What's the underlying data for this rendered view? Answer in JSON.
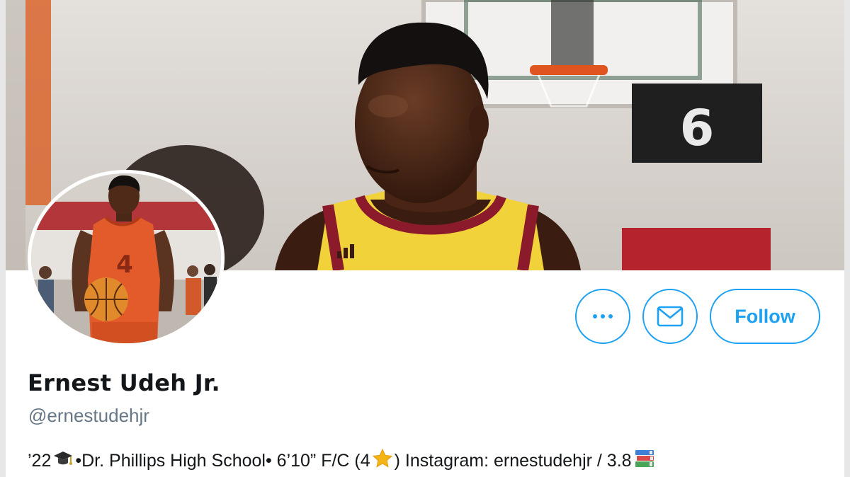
{
  "profile": {
    "display_name": "Ernest Udeh Jr.",
    "handle": "@ernestudehjr",
    "bio": {
      "year": "’22",
      "school": "•Dr. Phillips High School• 6’10” F/C (4",
      "instagram": ") Instagram: ernestudehjr / 3.8",
      "emoji_1": "graduation-cap-icon",
      "emoji_2": "star-icon",
      "emoji_3": "books-icon"
    }
  },
  "actions": {
    "follow_label": "Follow",
    "more_icon": "more-icon",
    "message_icon": "envelope-icon"
  },
  "colors": {
    "accent": "#1da1f2",
    "name": "#14171a",
    "handle": "#657786",
    "jersey_banner": "#f2d23a",
    "jersey_trim": "#8b1a2b",
    "jersey_avatar": "#e35a2b"
  },
  "banner": {
    "backboard_number": "6"
  },
  "avatar": {
    "jersey_number": "4"
  }
}
